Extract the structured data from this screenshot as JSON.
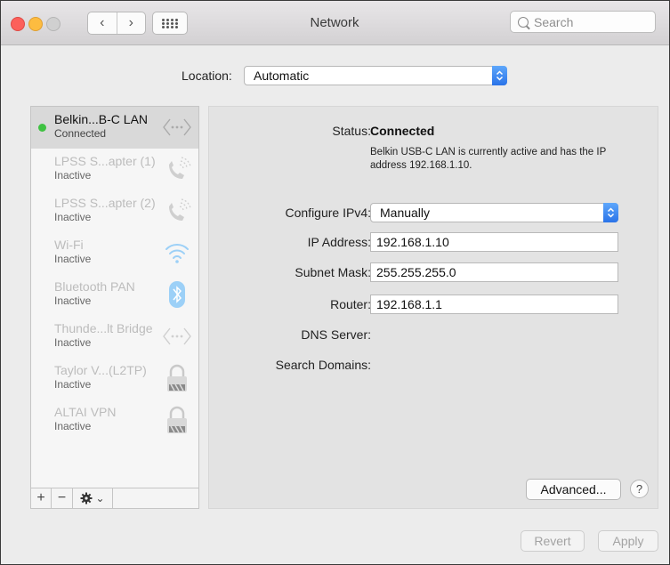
{
  "window": {
    "title": "Network"
  },
  "search": {
    "placeholder": "Search"
  },
  "location": {
    "label": "Location:",
    "value": "Automatic"
  },
  "services": [
    {
      "name": "Belkin...B-C LAN",
      "status": "Connected",
      "icon": "ethernet-icon",
      "selected": true
    },
    {
      "name": "LPSS S...apter (1)",
      "status": "Inactive",
      "icon": "phone-icon"
    },
    {
      "name": "LPSS S...apter (2)",
      "status": "Inactive",
      "icon": "phone-icon"
    },
    {
      "name": "Wi-Fi",
      "status": "Inactive",
      "icon": "wifi-icon"
    },
    {
      "name": "Bluetooth PAN",
      "status": "Inactive",
      "icon": "bluetooth-icon"
    },
    {
      "name": "Thunde...lt Bridge",
      "status": "Inactive",
      "icon": "ethernet-icon"
    },
    {
      "name": "Taylor V...(L2TP)",
      "status": "Inactive",
      "icon": "lock-icon"
    },
    {
      "name": "ALTAI VPN",
      "status": "Inactive",
      "icon": "lock-icon"
    }
  ],
  "toolbar": {
    "add": "+",
    "remove": "−",
    "gear_caret": "⌄"
  },
  "detail": {
    "status_label": "Status:",
    "status_value": "Connected",
    "status_desc": "Belkin USB-C LAN is currently active and has the IP address 192.168.1.10.",
    "configure_label": "Configure IPv4:",
    "configure_value": "Manually",
    "ip_label": "IP Address:",
    "ip_value": "192.168.1.10",
    "subnet_label": "Subnet Mask:",
    "subnet_value": "255.255.255.0",
    "router_label": "Router:",
    "router_value": "192.168.1.1",
    "dns_label": "DNS Server:",
    "search_domains_label": "Search Domains:"
  },
  "buttons": {
    "advanced": "Advanced...",
    "help": "?",
    "revert": "Revert",
    "apply": "Apply"
  },
  "colors": {
    "connected": "#3fc242",
    "accent": "#2a73e8"
  }
}
